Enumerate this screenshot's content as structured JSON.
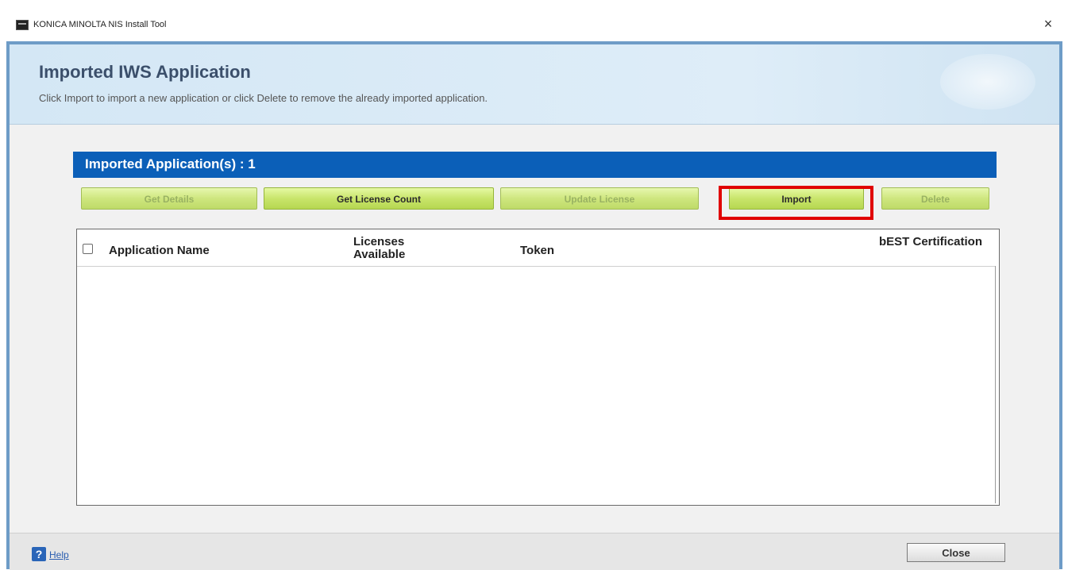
{
  "window": {
    "title": "KONICA MINOLTA NIS Install Tool",
    "close_glyph": "×"
  },
  "header": {
    "title": "Imported IWS Application",
    "description": "Click Import to import a new application or click Delete to remove the already imported application."
  },
  "panel": {
    "title": "Imported Application(s) : 1"
  },
  "toolbar": {
    "buttons": [
      {
        "label": "Get Details",
        "enabled": false
      },
      {
        "label": "Get License Count",
        "enabled": true
      },
      {
        "label": "Update License",
        "enabled": false
      },
      {
        "label": "Import",
        "enabled": true,
        "highlighted": true
      },
      {
        "label": "Delete",
        "enabled": false
      }
    ]
  },
  "table": {
    "columns": [
      "Application Name",
      "Licenses Available",
      "Token",
      "bEST Certification"
    ],
    "rows": []
  },
  "footer": {
    "help_icon_glyph": "?",
    "help_label": "Help",
    "close_label": "Close"
  },
  "colors": {
    "panel_bar": "#0b5fb8",
    "button_green": "#c9e56b",
    "highlight_red": "#e00000"
  }
}
